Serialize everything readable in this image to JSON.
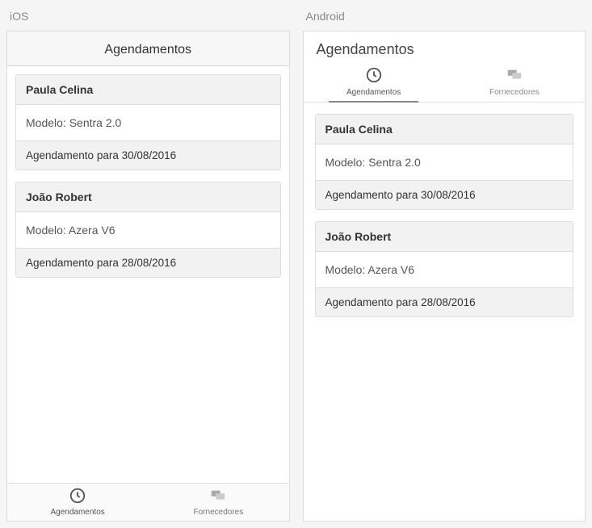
{
  "panels": {
    "ios_label": "iOS",
    "android_label": "Android"
  },
  "header_title": "Agendamentos",
  "tabs": {
    "agendamentos": "Agendamentos",
    "fornecedores": "Fornecedores"
  },
  "cards": [
    {
      "name": "Paula Celina",
      "model": "Modelo: Sentra 2.0",
      "schedule": "Agendamento para 30/08/2016"
    },
    {
      "name": "João Robert",
      "model": "Modelo: Azera V6",
      "schedule": "Agendamento para 28/08/2016"
    }
  ]
}
